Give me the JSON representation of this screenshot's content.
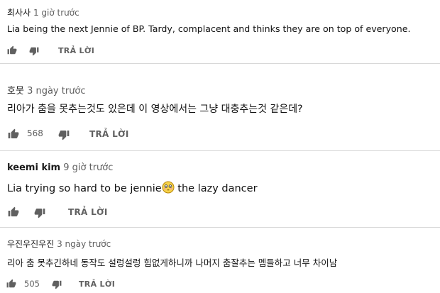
{
  "comments": [
    {
      "author": "최사사",
      "time": "1 giờ trước",
      "text": "Lia being the next Jennie of BP. Tardy, complacent and thinks they are on top of everyone.",
      "likes": "",
      "reply_label": "TRẢ LỜI"
    },
    {
      "author": "호뭇",
      "time": "3 ngày trước",
      "text": "리아가 춤을 못추는것도 있은데 이 영상에서는 그냥 대충추는것 같은데?",
      "likes": "568",
      "reply_label": "TRẢ LỜI"
    },
    {
      "author": "keemi kim",
      "time": "9 giờ trước",
      "text_before_emoji": "Lia trying so hard to be jennie",
      "emoji": "flushed-face",
      "text_after_emoji": " the lazy dancer",
      "likes": "",
      "reply_label": "TRẢ LỜI"
    },
    {
      "author": "우진우진우진",
      "time": "3 ngày trước",
      "text": "리아 춤 못추긴하네 동작도 설렁설렁 힘없게하니까 나머지 춤잘추는 멤들하고 너무 차이남",
      "likes": "505",
      "reply_label": "TRẢ LỜI"
    }
  ],
  "icons": {
    "like": "thumbs-up-icon",
    "dislike": "thumbs-down-icon"
  },
  "colors": {
    "meta": "#606060",
    "text": "#111111",
    "icon": "#606060"
  }
}
